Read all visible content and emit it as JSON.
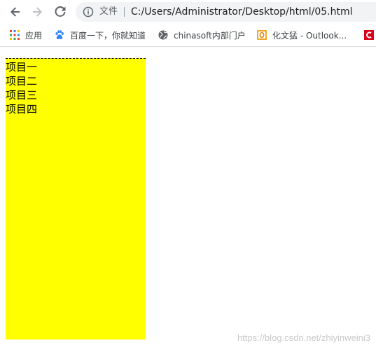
{
  "browser": {
    "omnibox": {
      "scheme_label": "文件",
      "url": "C:/Users/Administrator/Desktop/html/05.html"
    },
    "bookmarks": [
      {
        "label": "应用",
        "icon": "apps-grid-icon"
      },
      {
        "label": "百度一下，你就知道",
        "icon": "baidu-paw-icon"
      },
      {
        "label": "chinasoft内部门户",
        "icon": "globe-icon"
      },
      {
        "label": "化文猛 - Outlook...",
        "icon": "outlook-icon"
      },
      {
        "label": "",
        "icon": "red-c-icon"
      }
    ]
  },
  "page": {
    "list": {
      "background_color": "#ffff00",
      "items": [
        "项目一",
        "项目二",
        "项目三",
        "项目四"
      ]
    },
    "watermark": "https://blog.csdn.net/zhiyinweini3"
  }
}
